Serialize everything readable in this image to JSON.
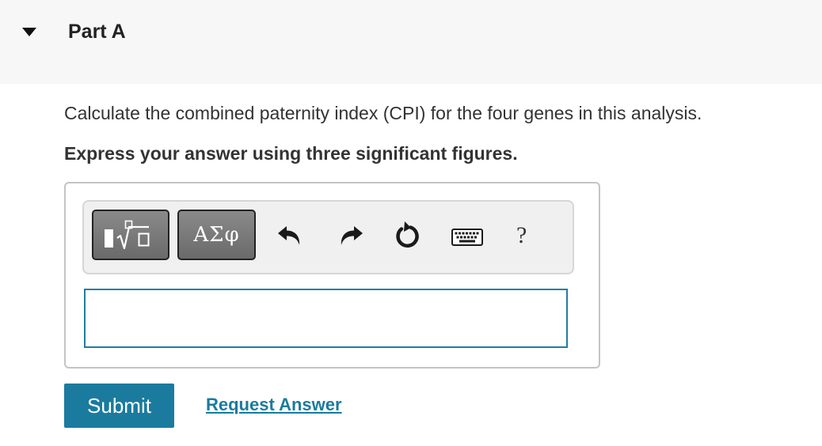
{
  "part": {
    "title": "Part A",
    "toggle_icon": "caret-down-icon"
  },
  "question": {
    "prompt": "Calculate the combined paternity index (CPI) for the four genes in this analysis.",
    "instruction": "Express your answer using three significant figures."
  },
  "toolbar": {
    "templates_icon": "math-templates-icon",
    "symbols_label": "ΑΣφ",
    "undo_icon": "undo-icon",
    "redo_icon": "redo-icon",
    "reset_icon": "reset-icon",
    "keyboard_icon": "keyboard-icon",
    "help_label": "?"
  },
  "answer": {
    "value": ""
  },
  "actions": {
    "submit_label": "Submit",
    "request_answer_label": "Request Answer"
  },
  "colors": {
    "accent": "#1a7b9e",
    "header_bg": "#f7f7f7",
    "tool_button": "#7a7a7a"
  }
}
